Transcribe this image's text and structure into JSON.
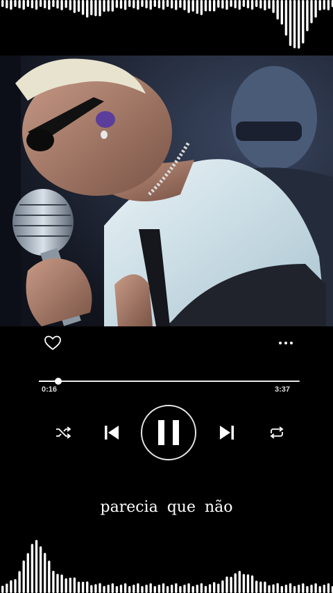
{
  "player": {
    "current_time": "0:16",
    "duration": "3:37",
    "progress_fraction": 0.074
  },
  "lyrics": {
    "line": "parecia  que  não"
  },
  "icons": {
    "like": "heart-icon",
    "more": "more-icon",
    "shuffle": "shuffle-icon",
    "previous": "skip-previous-icon",
    "play_pause": "pause-icon",
    "next": "skip-next-icon",
    "repeat": "repeat-icon"
  },
  "colors": {
    "background": "#000000",
    "foreground": "#ffffff"
  }
}
